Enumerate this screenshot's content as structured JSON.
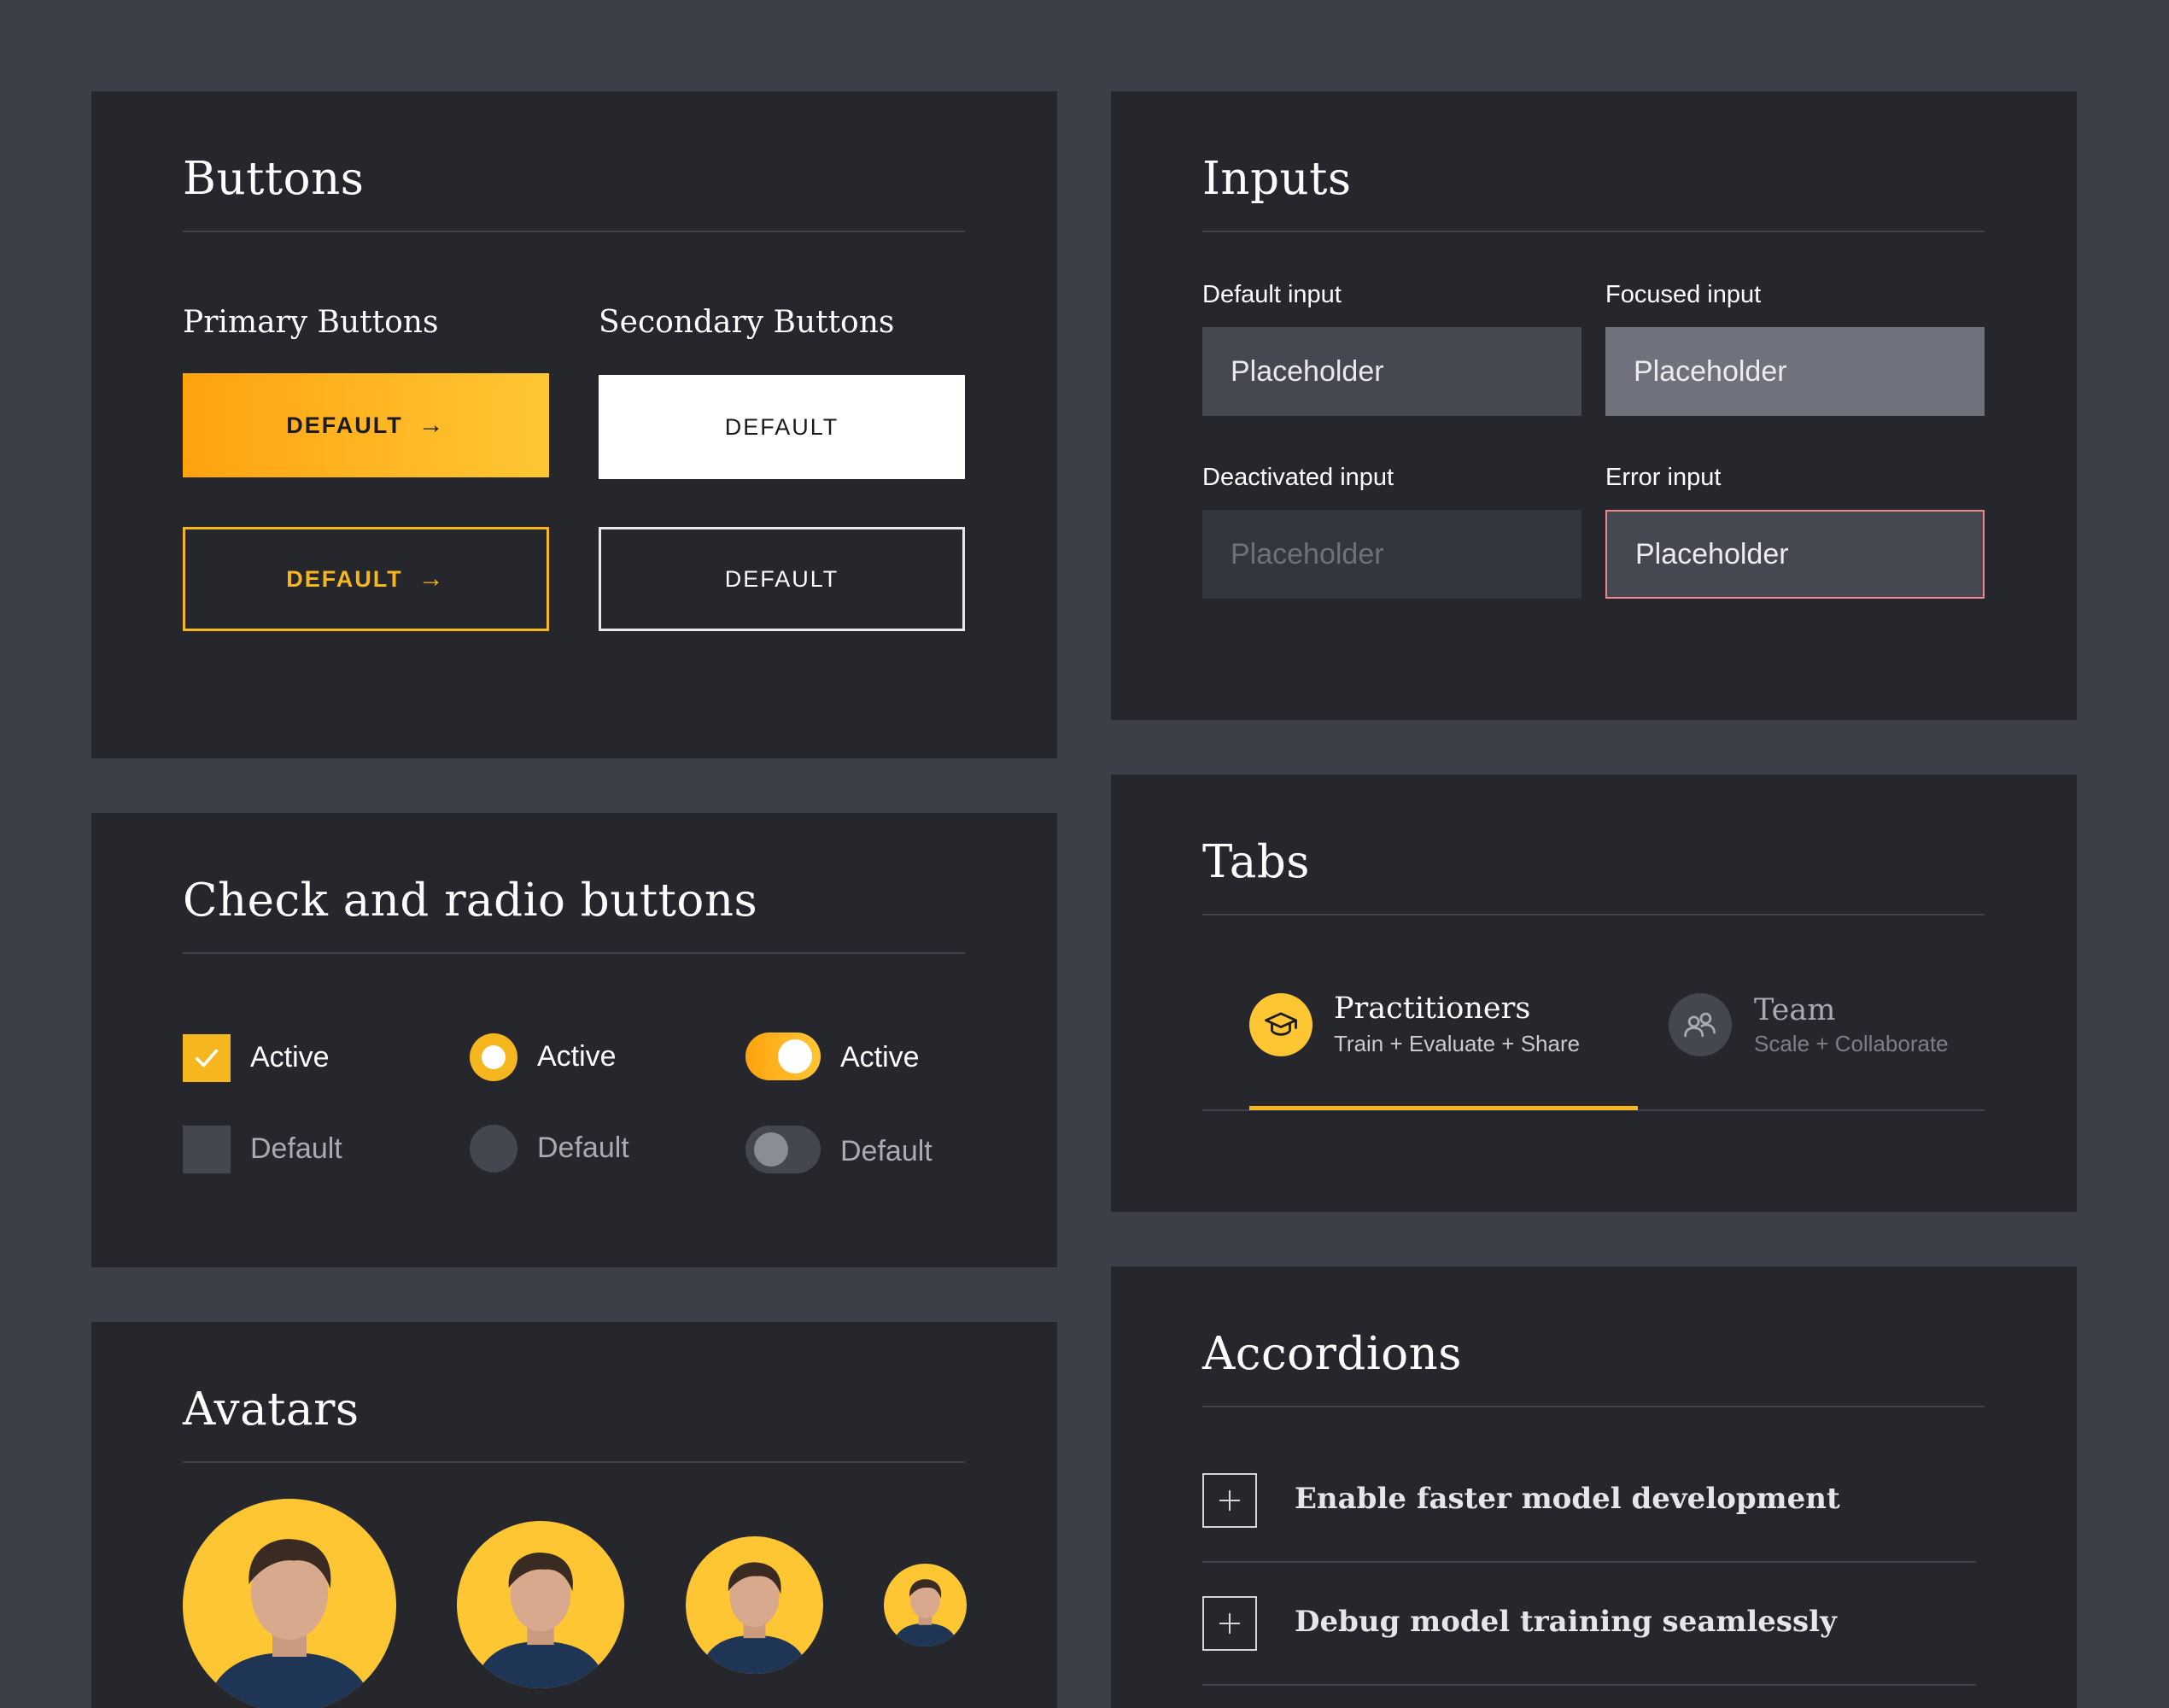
{
  "colors": {
    "page_bg": "#3c3f48",
    "card_bg": "#26272d",
    "accent": "#f6b61d",
    "accent_gradient_start": "#ffa30f",
    "accent_gradient_end": "#ffc634",
    "error": "#f08a8a"
  },
  "buttons": {
    "title": "Buttons",
    "primary_heading": "Primary Buttons",
    "secondary_heading": "Secondary Buttons",
    "primary_filled_label": "DEFAULT",
    "primary_outline_label": "DEFAULT",
    "secondary_filled_label": "DEFAULT",
    "secondary_outline_label": "DEFAULT",
    "arrow_icon": "arrow-right-icon"
  },
  "inputs": {
    "title": "Inputs",
    "default": {
      "label": "Default input",
      "placeholder": "Placeholder"
    },
    "focused": {
      "label": "Focused input",
      "placeholder": "Placeholder"
    },
    "deactivated": {
      "label": "Deactivated input",
      "placeholder": "Placeholder"
    },
    "error": {
      "label": "Error input",
      "placeholder": "Placeholder"
    }
  },
  "checks": {
    "title": "Check and radio buttons",
    "checkbox_active_label": "Active",
    "checkbox_default_label": "Default",
    "radio_active_label": "Active",
    "radio_default_label": "Default",
    "toggle_active_label": "Active",
    "toggle_default_label": "Default"
  },
  "tabs": {
    "title": "Tabs",
    "items": [
      {
        "title": "Practitioners",
        "subtitle": "Train + Evaluate + Share",
        "icon": "graduation-cap-icon",
        "active": true
      },
      {
        "title": "Team",
        "subtitle": "Scale + Collaborate",
        "icon": "users-icon",
        "active": false
      }
    ]
  },
  "avatars": {
    "title": "Avatars"
  },
  "accordions": {
    "title": "Accordions",
    "items": [
      {
        "label": "Enable faster model development",
        "icon": "plus-icon"
      },
      {
        "label": "Debug model training seamlessly",
        "icon": "plus-icon"
      }
    ]
  }
}
